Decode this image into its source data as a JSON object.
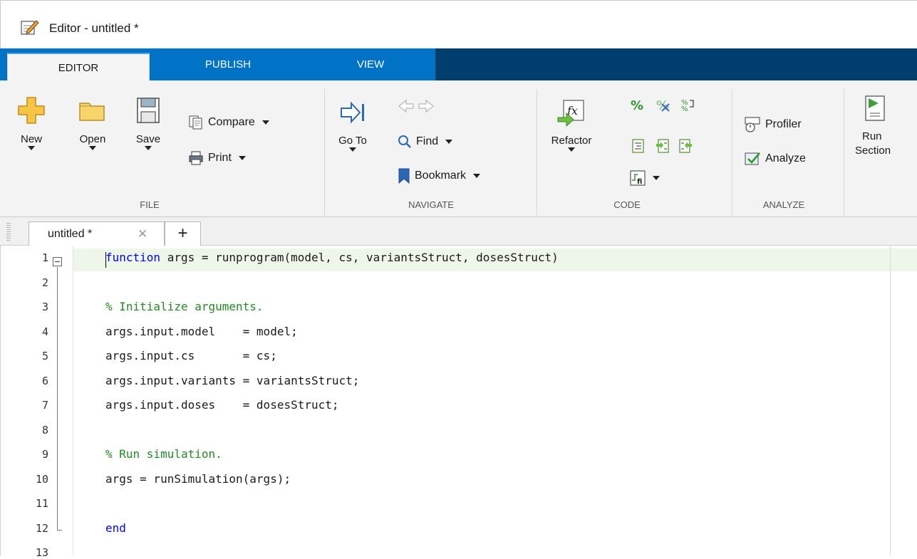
{
  "window": {
    "title": "Editor - untitled *"
  },
  "tabs": [
    {
      "label": "EDITOR",
      "active": true
    },
    {
      "label": "PUBLISH",
      "active": false
    },
    {
      "label": "VIEW",
      "active": false
    }
  ],
  "ribbon": {
    "file": {
      "group_label": "FILE",
      "new_label": "New",
      "open_label": "Open",
      "save_label": "Save",
      "compare_label": "Compare",
      "print_label": "Print"
    },
    "navigate": {
      "group_label": "NAVIGATE",
      "goto_label": "Go To",
      "find_label": "Find",
      "bookmark_label": "Bookmark"
    },
    "code": {
      "group_label": "CODE",
      "refactor_label": "Refactor"
    },
    "analyze": {
      "group_label": "ANALYZE",
      "profiler_label": "Profiler",
      "analyze_label": "Analyze"
    },
    "run": {
      "run_label": "Run",
      "section_label": "Section"
    }
  },
  "document_tabs": [
    {
      "label": "untitled *",
      "close": "✕"
    }
  ],
  "new_tab_label": "+",
  "colors": {
    "tab_strip_blue": "#0073c6",
    "tab_strip_dark": "#003e6e",
    "keyword": "#0000ff",
    "comment": "#228b22"
  },
  "editor": {
    "lines": [
      {
        "number": "1",
        "parts": [
          {
            "text": "function",
            "kind": "kw"
          },
          {
            "text": " args = runprogram(model, cs, variantsStruct, dosesStruct)",
            "kind": "plain"
          }
        ]
      },
      {
        "number": "2",
        "parts": []
      },
      {
        "number": "3",
        "parts": [
          {
            "text": "% Initialize arguments.",
            "kind": "cm"
          }
        ]
      },
      {
        "number": "4",
        "parts": [
          {
            "text": "args.input.model    = model;",
            "kind": "plain"
          }
        ]
      },
      {
        "number": "5",
        "parts": [
          {
            "text": "args.input.cs       = cs;",
            "kind": "plain"
          }
        ]
      },
      {
        "number": "6",
        "parts": [
          {
            "text": "args.input.variants = variantsStruct;",
            "kind": "plain"
          }
        ]
      },
      {
        "number": "7",
        "parts": [
          {
            "text": "args.input.doses    = dosesStruct;",
            "kind": "plain"
          }
        ]
      },
      {
        "number": "8",
        "parts": []
      },
      {
        "number": "9",
        "parts": [
          {
            "text": "% Run simulation.",
            "kind": "cm"
          }
        ]
      },
      {
        "number": "10",
        "parts": [
          {
            "text": "args = runSimulation(args);",
            "kind": "plain"
          }
        ]
      },
      {
        "number": "11",
        "parts": []
      },
      {
        "number": "12",
        "parts": [
          {
            "text": "end",
            "kind": "kw"
          }
        ]
      },
      {
        "number": "13",
        "parts": []
      }
    ]
  }
}
